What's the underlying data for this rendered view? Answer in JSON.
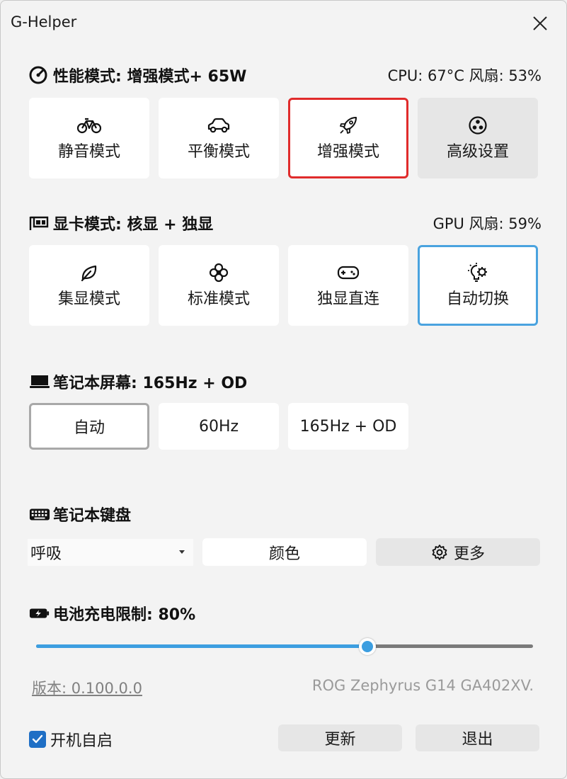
{
  "window": {
    "title": "G-Helper"
  },
  "performance": {
    "title": "性能模式: 增强模式+ 65W",
    "status": "CPU: 67°C 风扇: 53%",
    "modes": [
      {
        "label": "静音模式",
        "icon": "bicycle-icon"
      },
      {
        "label": "平衡模式",
        "icon": "car-icon"
      },
      {
        "label": "增强模式",
        "icon": "rocket-icon",
        "selected": true
      },
      {
        "label": "高级设置",
        "icon": "fan-icon"
      }
    ]
  },
  "gpu": {
    "title": "显卡模式: 核显 + 独显",
    "status": "GPU 风扇: 59%",
    "modes": [
      {
        "label": "集显模式",
        "icon": "leaf-icon"
      },
      {
        "label": "标准模式",
        "icon": "flower-icon"
      },
      {
        "label": "独显直连",
        "icon": "gamepad-icon"
      },
      {
        "label": "自动切换",
        "icon": "lightbulb-gear-icon",
        "selected": true
      }
    ]
  },
  "screen": {
    "title": "笔记本屏幕: 165Hz + OD",
    "options": [
      {
        "label": "自动",
        "selected": true
      },
      {
        "label": "60Hz"
      },
      {
        "label": "165Hz + OD"
      }
    ]
  },
  "keyboard": {
    "title": "笔记本键盘",
    "mode_value": "呼吸",
    "color_label": "颜色",
    "more_label": "更多"
  },
  "battery": {
    "title": "电池充电限制: 80%",
    "limit_percent": 80,
    "slider_fraction": 0.667
  },
  "footer": {
    "version": "版本: 0.100.0.0",
    "model": "ROG Zephyrus G14 GA402XV.",
    "autostart_label": "开机自启",
    "autostart_checked": true,
    "update_label": "更新",
    "quit_label": "退出"
  },
  "colors": {
    "accent_blue": "#3c9ee0",
    "selected_red": "#e02b2b",
    "selected_blue": "#4aa3df",
    "checkbox_blue": "#1f6fc5"
  }
}
